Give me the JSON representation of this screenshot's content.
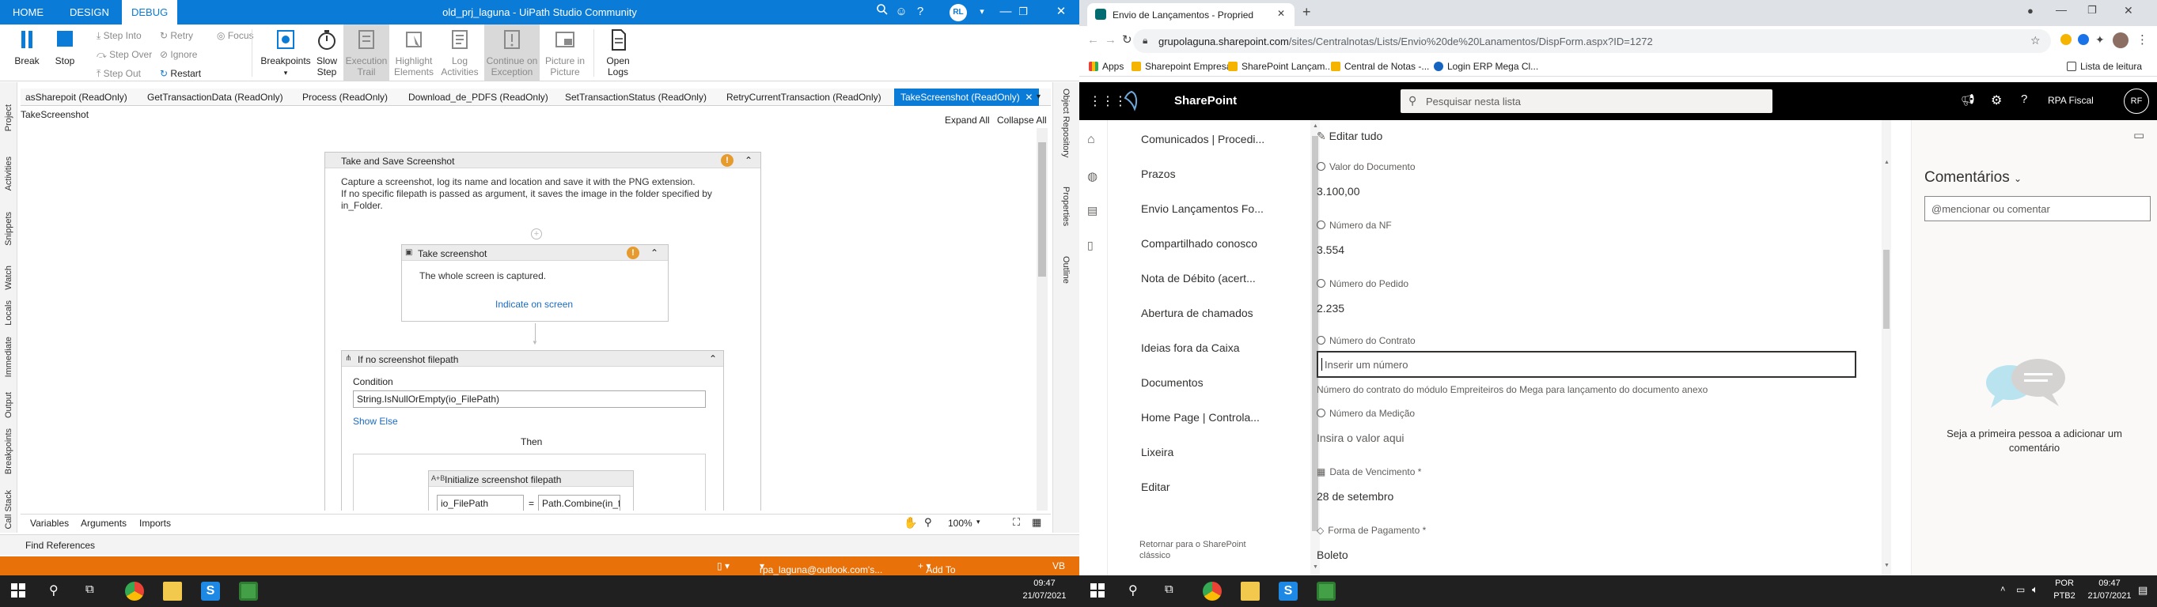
{
  "uipath": {
    "title": "old_prj_laguna - UiPath Studio Community",
    "tabs": [
      "HOME",
      "DESIGN",
      "DEBUG"
    ],
    "user_initials": "RL",
    "ribbon": {
      "break": "Break",
      "stop": "Stop",
      "step_into": "Step Into",
      "step_over": "Step Over",
      "step_out": "Step Out",
      "retry": "Retry",
      "ignore": "Ignore",
      "restart": "Restart",
      "focus": "Focus",
      "breakpoints": "Breakpoints",
      "slow_step_1": "Slow",
      "slow_step_2": "Step",
      "execution_trail_1": "Execution",
      "execution_trail_2": "Trail",
      "highlight_1": "Highlight",
      "highlight_2": "Elements",
      "log_1": "Log",
      "log_2": "Activities",
      "continue_1": "Continue on",
      "continue_2": "Exception",
      "pip_1": "Picture in",
      "pip_2": "Picture",
      "open_logs_1": "Open",
      "open_logs_2": "Logs"
    },
    "left_panels": [
      "Project",
      "Activities",
      "Snippets",
      "Watch",
      "Locals",
      "Immediate",
      "Output",
      "Breakpoints",
      "Call Stack"
    ],
    "right_panels": [
      "Object Repository",
      "Properties",
      "Outline"
    ],
    "doc_tabs": [
      "asSharepoit (ReadOnly)",
      "GetTransactionData (ReadOnly)",
      "Process (ReadOnly)",
      "Download_de_PDFS (ReadOnly)",
      "SetTransactionStatus (ReadOnly)",
      "RetryCurrentTransaction (ReadOnly)",
      "TakeScreenshot (ReadOnly)"
    ],
    "breadcrumb": "TakeScreenshot",
    "expand_all": "Expand All",
    "collapse_all": "Collapse All",
    "workflow": {
      "outer_title": "Take and Save Screenshot",
      "outer_desc_1": "Capture a screenshot, log its name and location and save it with the PNG extension.",
      "outer_desc_2": "If no specific filepath is passed as argument, it saves the image in the folder specified by",
      "outer_desc_3": "in_Folder.",
      "take_title": "Take screenshot",
      "take_desc": "The whole screen is captured.",
      "indicate": "Indicate on screen",
      "if_title": "If no screenshot filepath",
      "condition_label": "Condition",
      "condition_value": "String.IsNullOrEmpty(io_FilePath)",
      "show_else": "Show Else",
      "then": "Then",
      "assign_title": "Initialize screenshot filepath",
      "assign_to": "io_FilePath",
      "assign_eq": "=",
      "assign_value": "Path.Combine(in_f"
    },
    "bottom": {
      "variables": "Variables",
      "arguments": "Arguments",
      "imports": "Imports",
      "zoom": "100%"
    },
    "find_references": "Find References",
    "status": {
      "account": "rpa_laguna@outlook.com's...",
      "source_control": "Add To Source Control",
      "vb": "VB"
    }
  },
  "chrome": {
    "tab_title": "Envio de Lançamentos - Propried",
    "url_domain": "grupolaguna.sharepoint.com",
    "url_path": "/sites/Centralnotas/Lists/Envio%20de%20Lanamentos/DispForm.aspx?ID=1272",
    "bookmarks": [
      "Apps",
      "Sharepoint Empresas",
      "SharePoint Lançam...",
      "Central de Notas -...",
      "Login ERP Mega Cl..."
    ],
    "reading_list": "Lista de leitura"
  },
  "sharepoint": {
    "brand": "SharePoint",
    "search_placeholder": "Pesquisar nesta lista",
    "site_name": "RPA Fiscal",
    "user_initials": "RF",
    "nav": [
      "Comunicados | Procedi...",
      "Prazos",
      "Envio Lançamentos Fo...",
      "Compartilhado conosco",
      "Nota de Débito (acert...",
      "Abertura de chamados",
      "Ideias fora da Caixa",
      "Documentos",
      "Home Page | Controla...",
      "Lixeira",
      "Editar"
    ],
    "return_classic_1": "Retornar para o SharePoint",
    "return_classic_2": "clássico",
    "edit_all": "Editar tudo",
    "fields": {
      "valor_label": "Valor do Documento",
      "valor": "3.100,00",
      "nf_label": "Número da NF",
      "nf": "3.554",
      "pedido_label": "Número do Pedido",
      "pedido": "2.235",
      "contrato_label": "Número do Contrato",
      "contrato_placeholder": "Inserir um número",
      "contrato_help": "Número do contrato do módulo Empreiteiros do Mega para lançamento do documento anexo",
      "medicao_label": "Número da Medição",
      "medicao_placeholder": "Insira o valor aqui",
      "venc_label": "Data de Vencimento *",
      "venc": "28 de setembro",
      "pag_label": "Forma de Pagamento *",
      "pag": "Boleto"
    },
    "comments_title": "Comentários",
    "comments_placeholder": "@mencionar ou comentar",
    "comments_empty": "Seja a primeira pessoa a adicionar um comentário"
  },
  "taskbar": {
    "time": "09:47",
    "date": "21/07/2021",
    "lang_1": "POR",
    "lang_2": "PTB2"
  },
  "colors": {
    "uipath_blue": "#0a7bd6",
    "status_orange": "#e8710a",
    "sharepoint_header": "#000000",
    "warning": "#e69b2f"
  }
}
